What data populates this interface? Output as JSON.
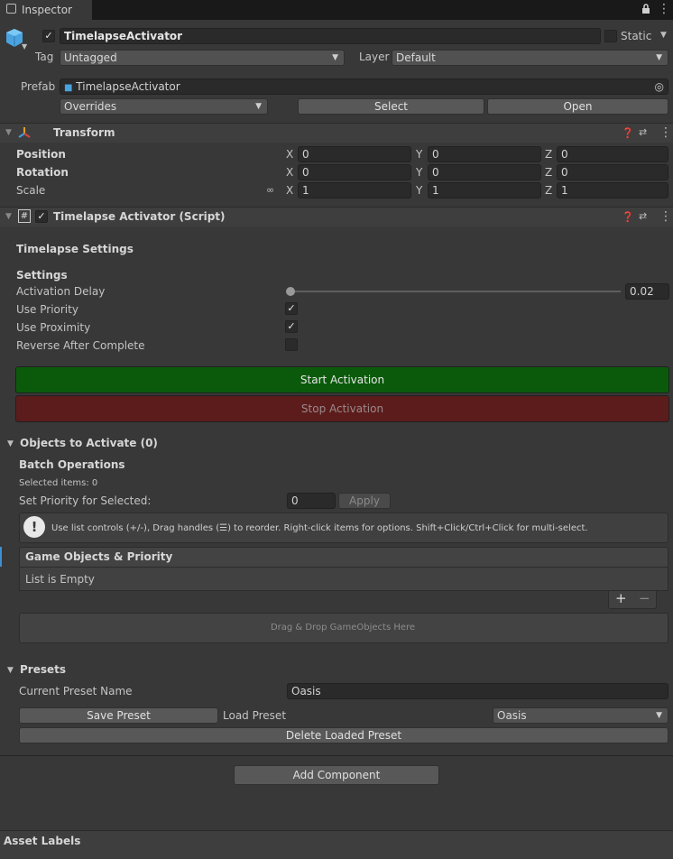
{
  "tab": {
    "title": "Inspector",
    "lock_icon": "lock-icon",
    "menu_icon": "kebab-menu-icon"
  },
  "object": {
    "enabled": true,
    "name": "TimelapseActivator",
    "static_label": "Static",
    "tag_label": "Tag",
    "tag_value": "Untagged",
    "layer_label": "Layer",
    "layer_value": "Default",
    "prefab_label": "Prefab",
    "prefab_value": "TimelapseActivator",
    "overrides_value": "Overrides",
    "select_label": "Select",
    "open_label": "Open"
  },
  "transform": {
    "title": "Transform",
    "rows": [
      {
        "label": "Position",
        "x": "0",
        "y": "0",
        "z": "0"
      },
      {
        "label": "Rotation",
        "x": "0",
        "y": "0",
        "z": "0"
      },
      {
        "label": "Scale",
        "x": "1",
        "y": "1",
        "z": "1"
      }
    ],
    "axis_x": "X",
    "axis_y": "Y",
    "axis_z": "Z"
  },
  "script": {
    "hash": "#",
    "title": "Timelapse Activator (Script)",
    "timelapse_settings": "Timelapse Settings",
    "settings": "Settings",
    "activation_delay_label": "Activation Delay",
    "activation_delay_value": "0.02",
    "activation_delay_fraction": 0.0,
    "use_priority_label": "Use Priority",
    "use_priority": true,
    "use_proximity_label": "Use Proximity",
    "use_proximity": true,
    "reverse_label": "Reverse After Complete",
    "reverse": false,
    "start_label": "Start Activation",
    "stop_label": "Stop Activation",
    "colors": {
      "start": "#0b5a0b",
      "stop": "#5c1c1c"
    }
  },
  "objects": {
    "title": "Objects to Activate (0)",
    "batch_title": "Batch Operations",
    "selected_items": "Selected items: 0",
    "set_priority_label": "Set Priority for Selected:",
    "priority_value": "0",
    "apply_label": "Apply",
    "help_text": "Use list controls (+/-), Drag handles (☰) to reorder. Right-click items for options. Shift+Click/Ctrl+Click for multi-select.",
    "list_header": "Game Objects & Priority",
    "list_empty": "List is Empty",
    "plus": "+",
    "minus": "−",
    "drop_zone": "Drag & Drop GameObjects Here"
  },
  "presets": {
    "title": "Presets",
    "current_label": "Current Preset Name",
    "current_value": "Oasis",
    "save_label": "Save Preset",
    "load_label": "Load Preset",
    "load_value": "Oasis",
    "delete_label": "Delete Loaded Preset"
  },
  "footer": {
    "add_component": "Add Component",
    "asset_labels": "Asset Labels"
  }
}
